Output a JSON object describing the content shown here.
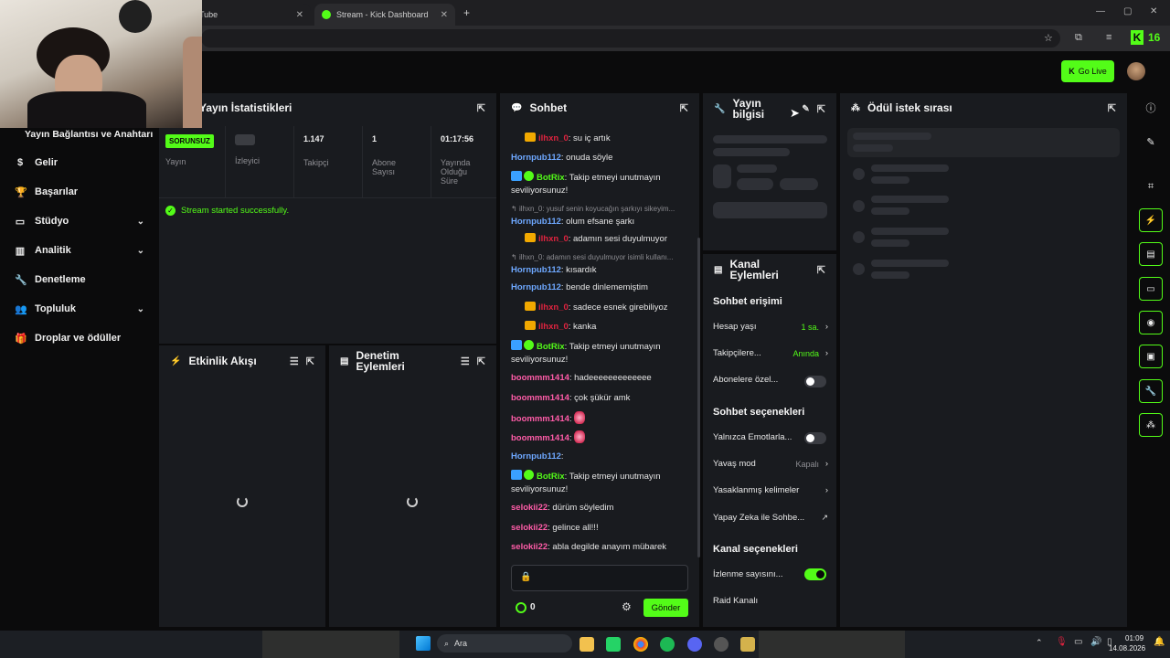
{
  "browser": {
    "tabs": [
      {
        "label": "Tube"
      },
      {
        "label": "Stream - Kick Dashboard"
      }
    ],
    "new_tab": "+",
    "ext_count": "16"
  },
  "header": {
    "go_live": "Go Live"
  },
  "sidebar": {
    "section_label": "Yayın Bağlantısı ve Anahtarı",
    "items": [
      {
        "label": "Gelir",
        "icon": "dollar-icon"
      },
      {
        "label": "Başarılar",
        "icon": "trophy-icon"
      },
      {
        "label": "Stüdyo",
        "icon": "tv-icon",
        "expandable": true
      },
      {
        "label": "Analitik",
        "icon": "chart-icon",
        "expandable": true
      },
      {
        "label": "Denetleme",
        "icon": "wrench-icon"
      },
      {
        "label": "Topluluk",
        "icon": "people-icon",
        "expandable": true
      },
      {
        "label": "Droplar ve ödüller",
        "icon": "gift-icon"
      }
    ]
  },
  "stats_panel": {
    "title": "Yayın İstatistikleri",
    "status_badge": "SORUNSUZ",
    "columns": [
      {
        "value": "",
        "label": "Yayın"
      },
      {
        "value": "",
        "label": "İzleyici"
      },
      {
        "value": "1.147",
        "label": "Takipçi"
      },
      {
        "value": "1",
        "label": "Abone Sayısı"
      },
      {
        "value": "01:17:56",
        "label": "Yayında Olduğu Süre"
      }
    ],
    "message": "Stream started successfully."
  },
  "activity_panel": {
    "title": "Etkinlik Akışı"
  },
  "moderation_panel": {
    "title": "Denetim Eylemleri"
  },
  "chat_panel": {
    "title": "Sohbet",
    "messages": [
      {
        "user": "ilhxn_0",
        "text": ": su iç artık"
      },
      {
        "user": "Hornpub112",
        "text": ": onuda söyle"
      },
      {
        "user": "BotRix",
        "text": ": Takip etmeyi unutmayın seviliyorsunuz!"
      },
      {
        "reply": "ilhxn_0: yusuf senin koyucağın şarkıyı sikeyim...",
        "user": "Hornpub112",
        "text": ": olum efsane şarkı"
      },
      {
        "user": "ilhxn_0",
        "text": ": adamın sesi duyulmuyor"
      },
      {
        "reply": "ilhxn_0: adamın sesi duyulmuyor isimli kullanı...",
        "user": "Hornpub112",
        "text": ": kısardık"
      },
      {
        "user": "Hornpub112",
        "text": ": bende dinlememiştim"
      },
      {
        "user": "ilhxn_0",
        "text": ": sadece esnek girebiliyoz"
      },
      {
        "user": "ilhxn_0",
        "text": ": kanka"
      },
      {
        "user": "BotRix",
        "text": ": Takip etmeyi unutmayın seviliyorsunuz!"
      },
      {
        "user": "boommm1414",
        "text": ": hadeeeeeeeeeeeee"
      },
      {
        "user": "boommm1414",
        "text": ": çok şükür amk"
      },
      {
        "user": "boommm1414",
        "text": ":"
      },
      {
        "user": "boommm1414",
        "text": ":"
      },
      {
        "user": "Hornpub112",
        "text": ":"
      },
      {
        "user": "BotRix",
        "text": ": Takip etmeyi unutmayın seviliyorsunuz!"
      },
      {
        "user": "selokii22",
        "text": ": dürüm söyledim"
      },
      {
        "user": "selokii22",
        "text": ": gelince all!!!"
      },
      {
        "user": "selokii22",
        "text": ": abla degilde anayım mübarek"
      }
    ],
    "points": "0",
    "send": "Gönder"
  },
  "stream_info": {
    "title": "Yayın bilgisi"
  },
  "channel_actions": {
    "title": "Kanal Eylemleri",
    "chat_access_head": "Sohbet erişimi",
    "account_age": {
      "label": "Hesap yaşı",
      "value": "1 sa."
    },
    "followers": {
      "label": "Takipçilere...",
      "value": "Anında"
    },
    "subs_only": {
      "label": "Abonelere özel...",
      "on": false
    },
    "chat_options_head": "Sohbet seçenekleri",
    "emotes_only": {
      "label": "Yalnızca Emotlarla...",
      "on": false
    },
    "slow_mode": {
      "label": "Yavaş mod",
      "value": "Kapalı"
    },
    "banned_words": {
      "label": "Yasaklanmış kelimeler"
    },
    "ai": {
      "label": "Yapay Zeka ile Sohbe..."
    },
    "channel_options_head": "Kanal seçenekleri",
    "view_count": {
      "label": "İzlenme sayısını...",
      "on": true
    },
    "raid": {
      "label": "Raid Kanalı"
    }
  },
  "rewards_panel": {
    "title": "Ödül istek sırası"
  },
  "taskbar": {
    "search": "Ara",
    "time": "01:09",
    "date": "14.08.2026"
  },
  "colors": {
    "accent": "#53fc18",
    "panel": "#191b1f"
  }
}
